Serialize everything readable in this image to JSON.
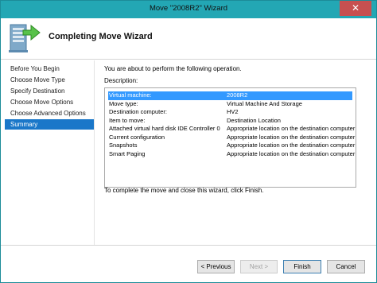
{
  "window": {
    "title": "Move \"2008R2\" Wizard",
    "close_glyph": "✕"
  },
  "header": {
    "heading": "Completing Move Wizard",
    "icon": "server-move-icon"
  },
  "steps": [
    {
      "label": "Before You Begin",
      "active": false
    },
    {
      "label": "Choose Move Type",
      "active": false
    },
    {
      "label": "Specify Destination",
      "active": false
    },
    {
      "label": "Choose Move Options",
      "active": false
    },
    {
      "label": "Choose Advanced Options",
      "active": false
    },
    {
      "label": "Summary",
      "active": true
    }
  ],
  "content": {
    "intro": "You are about to perform the following operation.",
    "description_label": "Description:",
    "rows": [
      {
        "key": "Virtual machine:",
        "value": "2008R2",
        "selected": true
      },
      {
        "key": "Move type:",
        "value": "Virtual Machine And Storage"
      },
      {
        "key": "Destination computer:",
        "value": "HV2"
      },
      {
        "key": "Item to move:",
        "value": "Destination Location"
      },
      {
        "key": "Attached virtual hard disk  IDE Controller 0",
        "value": "Appropriate location on the destination computer"
      },
      {
        "key": "Current configuration",
        "value": "Appropriate location on the destination computer"
      },
      {
        "key": "Snapshots",
        "value": "Appropriate location on the destination computer"
      },
      {
        "key": "Smart Paging",
        "value": "Appropriate location on the destination computer"
      }
    ],
    "finish_text": "To complete the move and close this wizard, click Finish."
  },
  "buttons": {
    "previous": "< Previous",
    "next": "Next >",
    "finish": "Finish",
    "cancel": "Cancel"
  },
  "colors": {
    "titlebar": "#23a7b4",
    "close": "#c75050",
    "active_step": "#1a77c9",
    "selected_row": "#3399ff"
  }
}
